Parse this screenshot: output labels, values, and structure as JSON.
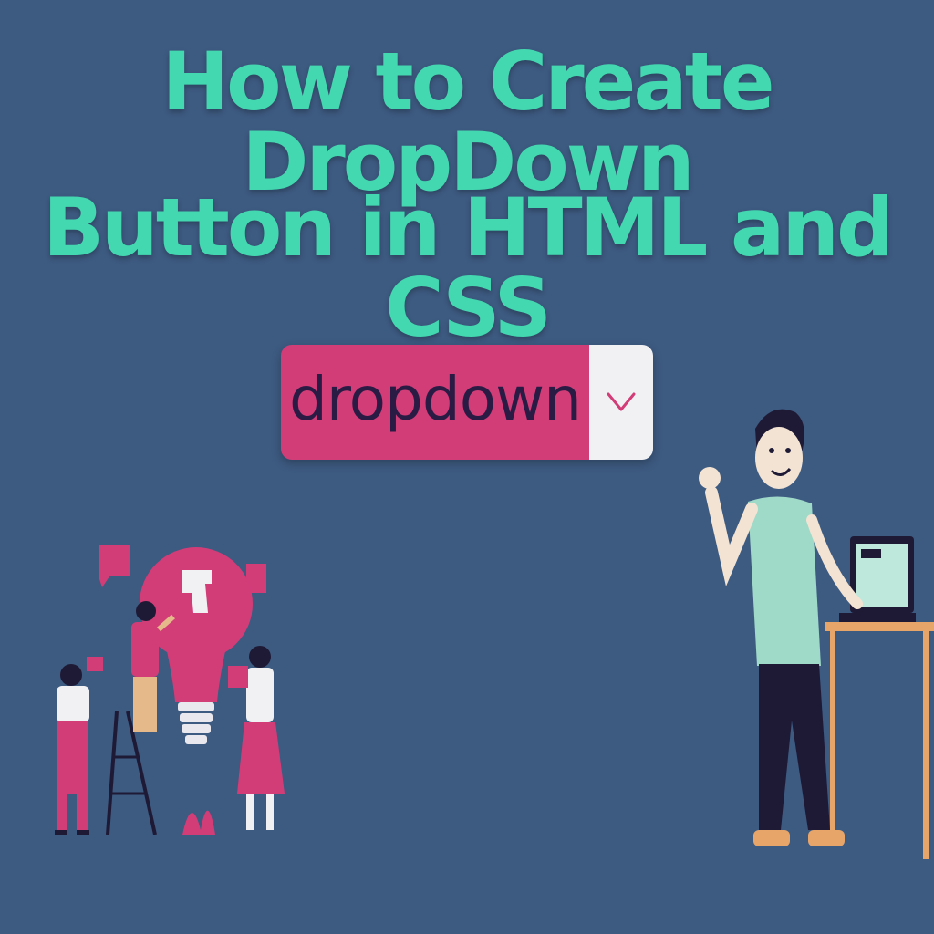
{
  "heading": {
    "line1": "How to Create DropDown",
    "line2": "Button in HTML and CSS"
  },
  "dropdown": {
    "label": "dropdown",
    "icon": "chevron-down-icon"
  },
  "colors": {
    "background": "#3d5a80",
    "heading": "#43d8b0",
    "dropdown_fill": "#d23d78",
    "dropdown_text": "#2a1b44",
    "caret_fill": "#f1f1f4",
    "caret_stroke": "#d23d78"
  }
}
